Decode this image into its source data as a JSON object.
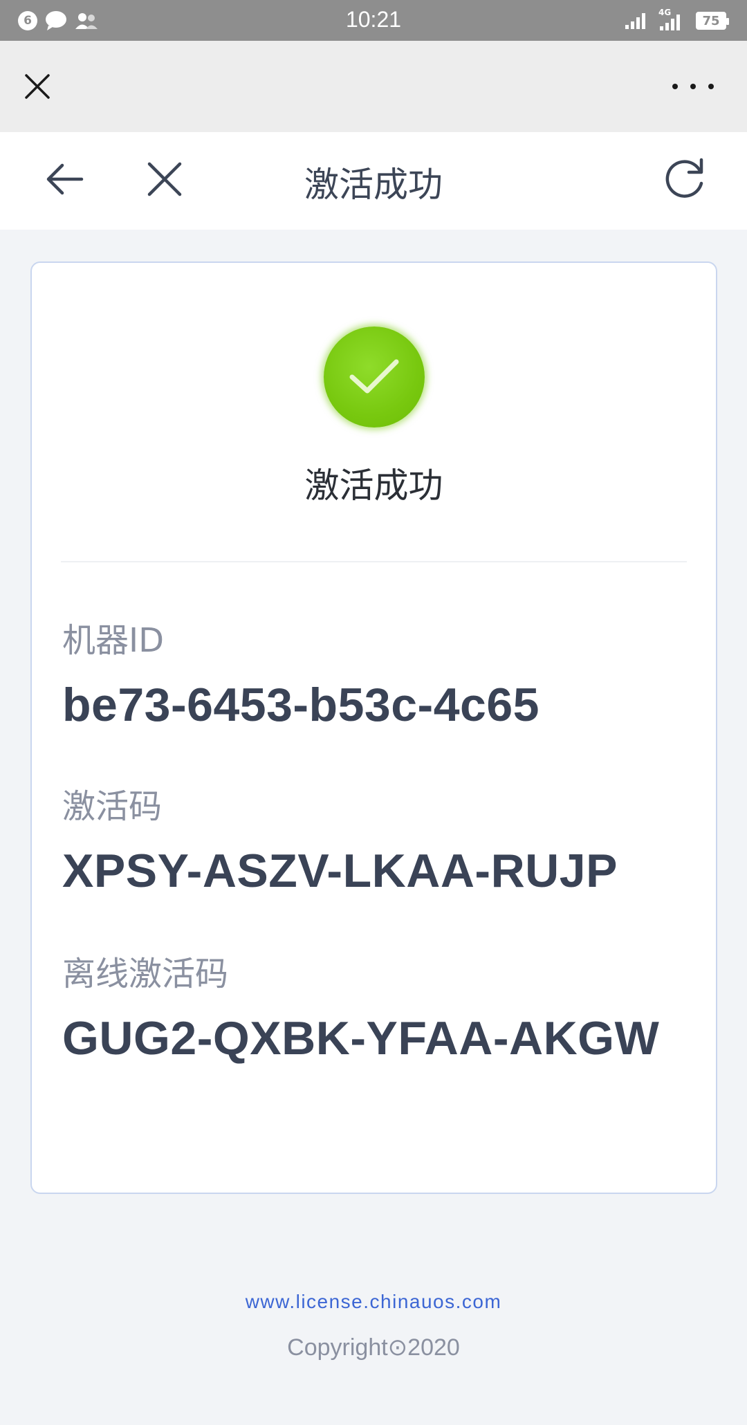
{
  "status_bar": {
    "notification_count": "6",
    "time": "10:21",
    "network_label": "4G",
    "battery": "75"
  },
  "header": {
    "title": "激活成功"
  },
  "card": {
    "success_title": "激活成功",
    "fields": [
      {
        "label": "机器ID",
        "value": "be73-6453-b53c-4c65"
      },
      {
        "label": "激活码",
        "value": "XPSY-ASZV-LKAA-RUJP"
      },
      {
        "label": "离线激活码",
        "value": "GUG2-QXBK-YFAA-AKGW"
      }
    ]
  },
  "footer": {
    "link": "www.license.chinauos.com",
    "copyright": "Copyright⊙2020"
  },
  "colors": {
    "success_green": "#78c80f",
    "link_blue": "#3c66d4",
    "card_border": "#c9d6ef"
  }
}
